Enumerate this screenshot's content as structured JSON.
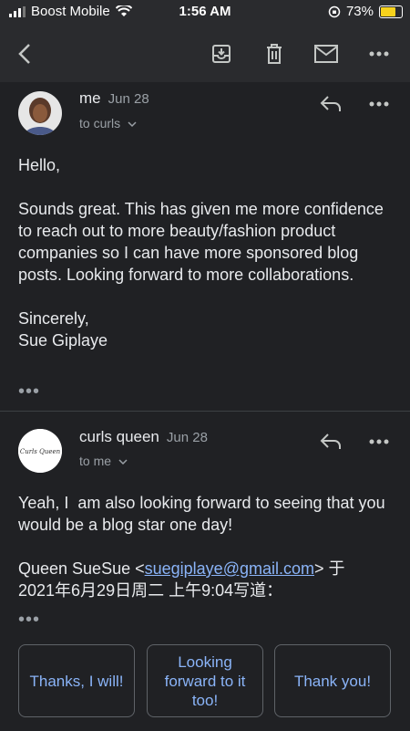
{
  "status_bar": {
    "carrier": "Boost Mobile",
    "time": "1:56 AM",
    "battery": "73%"
  },
  "toolbar": {
    "icons": [
      "back-arrow-icon",
      "archive-icon",
      "trash-icon",
      "mail-icon",
      "more-icon"
    ]
  },
  "messages": [
    {
      "sender": "me",
      "date": "Jun 28",
      "recipient": "to curls",
      "body": "Hello,\n\nSounds great. This has given me more confidence to reach out to more beauty/fashion product companies so I can have more sponsored blog posts. Looking forward to more collaborations.\n\nSincerely,\nSue Giplaye",
      "ellipsis": "•••"
    },
    {
      "sender": "curls queen",
      "date": "Jun 28",
      "recipient": "to me",
      "avatar_text": "CurlsQueen",
      "body": "Yeah, I  am also looking forward to seeing that you would be a blog star one day!",
      "quote_prefix": "Queen SueSue <",
      "quote_email": "suegiplaye@gmail.com",
      "quote_suffix": "> 于",
      "quote_line2": "2021年6月29日周二 上午9:04写道：",
      "ellipsis": "•••"
    }
  ],
  "smart_replies": [
    "Thanks, I will!",
    "Looking forward to it too!",
    "Thank you!"
  ],
  "colors": {
    "background": "#202124",
    "toolbar": "#2a2b2e",
    "link": "#8ab4f8",
    "secondary_text": "#9aa0a6",
    "battery": "#f7d21c"
  }
}
